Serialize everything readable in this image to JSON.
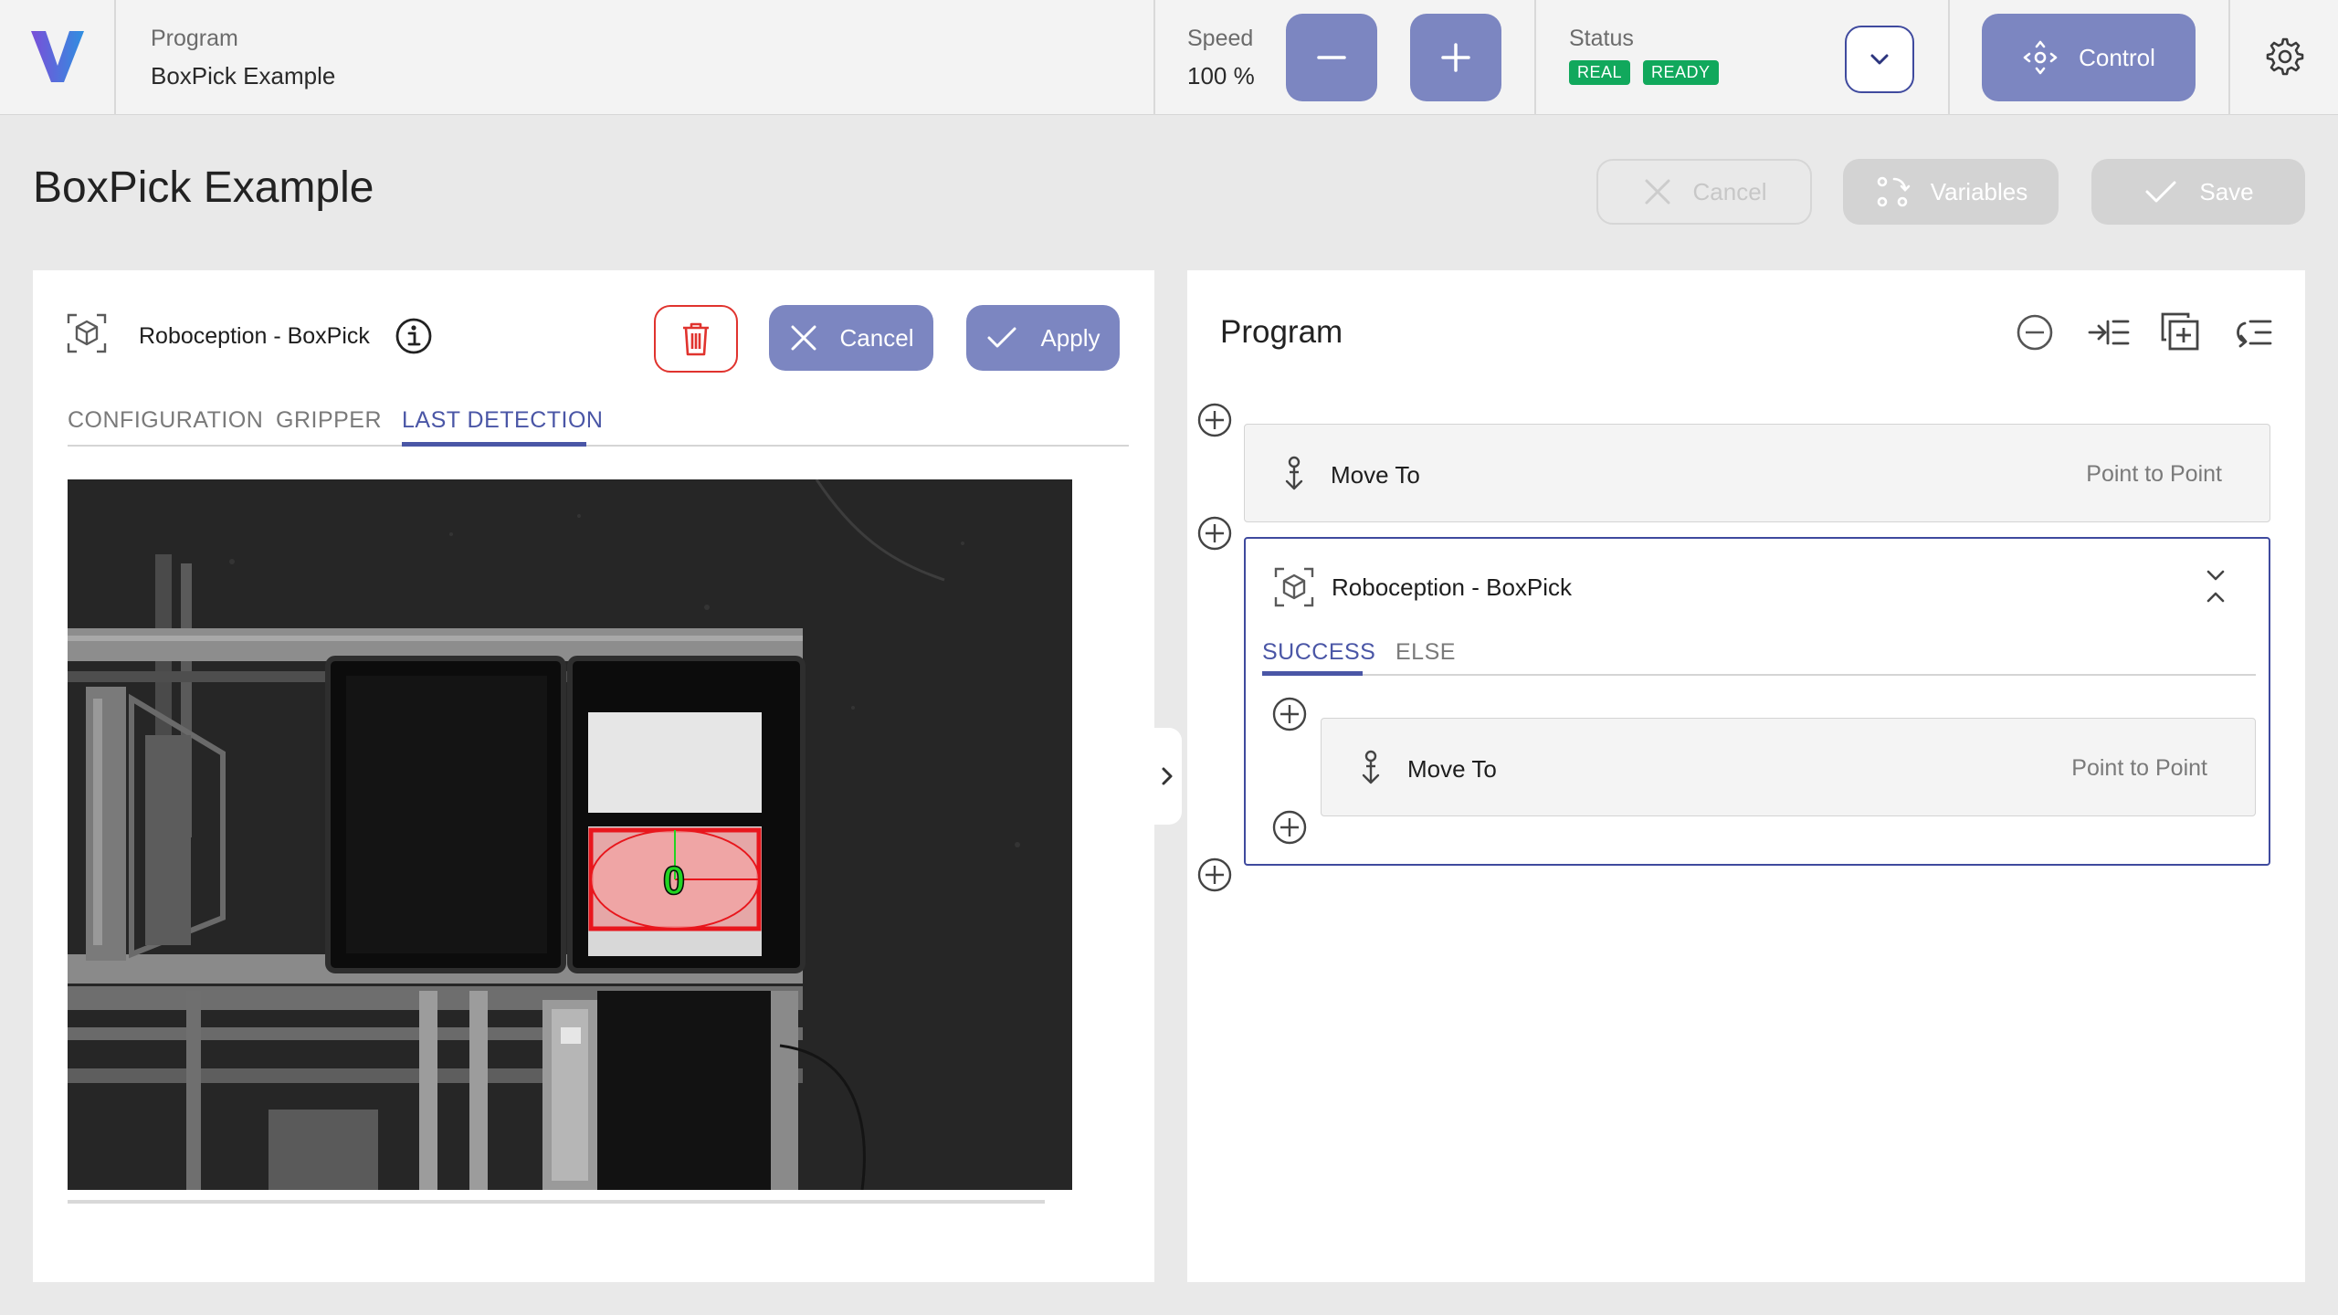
{
  "topbar": {
    "logo_letter": "V",
    "program_label": "Program",
    "program_name": "BoxPick Example",
    "speed_label": "Speed",
    "speed_value": "100 %",
    "status_label": "Status",
    "status_tags": [
      "REAL",
      "READY"
    ],
    "control_label": "Control"
  },
  "header": {
    "title": "BoxPick Example",
    "cancel_label": "Cancel",
    "variables_label": "Variables",
    "save_label": "Save"
  },
  "left_panel": {
    "node_title": "Roboception - BoxPick",
    "cancel_label": "Cancel",
    "apply_label": "Apply",
    "tabs": [
      "CONFIGURATION",
      "GRIPPER",
      "LAST DETECTION"
    ],
    "active_tab": "LAST DETECTION",
    "detection_label": "0"
  },
  "program_panel": {
    "title": "Program",
    "steps": [
      {
        "title": "Move To",
        "subtitle": "Point to Point"
      },
      {
        "title": "Roboception - BoxPick"
      }
    ],
    "branch_tabs": [
      "SUCCESS",
      "ELSE"
    ],
    "active_branch": "SUCCESS",
    "nested_step": {
      "title": "Move To",
      "subtitle": "Point to Point"
    }
  },
  "colors": {
    "accent": "#7c86c1",
    "accent_dark": "#4a56a6",
    "status_green": "#11a85c",
    "delete_red": "#e0332e",
    "detection_red": "#e8161c",
    "detection_green": "#22d422"
  }
}
